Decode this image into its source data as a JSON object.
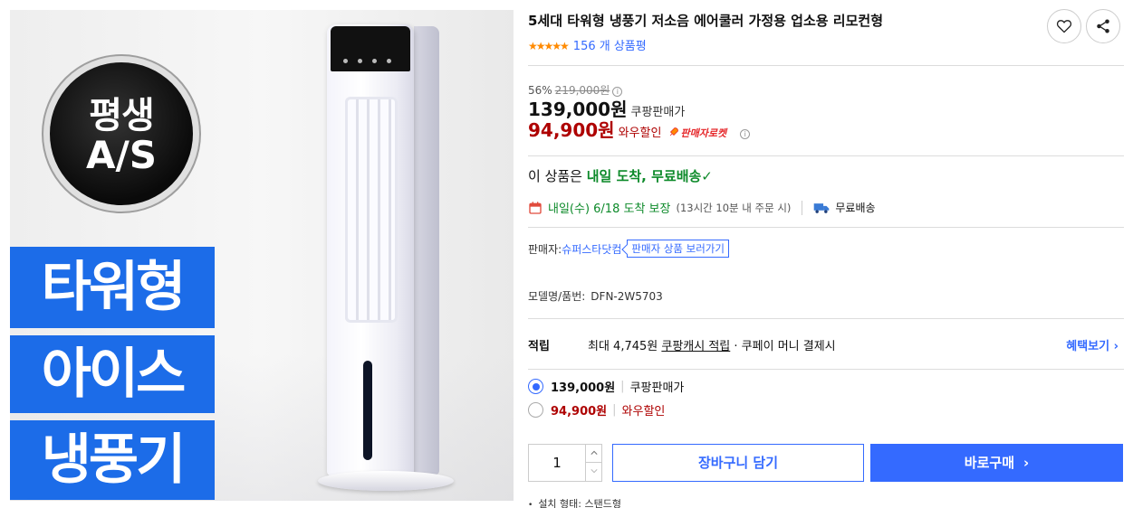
{
  "product": {
    "title": "5세대 타워형 냉풍기 저소음 에어쿨러 가정용 업소용 리모컨형",
    "stars": "★★★★★",
    "review_count": "156 개 상품평"
  },
  "image": {
    "badge_line1": "평생",
    "badge_line2": "A/S",
    "banner1": "타워형",
    "banner2": "아이스",
    "banner3": "냉풍기"
  },
  "price": {
    "discount_rate": "56%",
    "original": "219,000원",
    "sale": "139,000원",
    "sale_label": "쿠팡판매가",
    "wow": "94,900원",
    "wow_label": "와우할인",
    "rocket_label": "판매자로켓",
    "info_glyph": "i"
  },
  "delivery": {
    "headline_prefix": "이 상품은 ",
    "headline_green": "내일 도착, 무료배송",
    "check": "✓",
    "date": "내일(수) 6/18 도착 보장",
    "cutoff": "(13시간 10분 내 주문 시)",
    "free_shipping": "무료배송"
  },
  "seller": {
    "label": "판매자: ",
    "name": "슈퍼스타닷컴",
    "products_link": "판매자 상품 보러가기"
  },
  "model": {
    "label": "모델명/품번:",
    "code": "DFN-2W5703"
  },
  "cash": {
    "label": "적립",
    "max_text": "최대 4,745원 ",
    "coupang_cash": "쿠팡캐시 적립",
    "pay_text": " · 쿠페이 머니 결제시",
    "benefit_link": "혜택보기 ›"
  },
  "options": [
    {
      "price": "139,000원",
      "label": "쿠팡판매가",
      "selected": true
    },
    {
      "price": "94,900원",
      "label": "와우할인",
      "selected": false
    }
  ],
  "purchase": {
    "quantity": "1",
    "cart_button": "장바구니 담기",
    "buy_button": "바로구매",
    "buy_chevron": "›"
  },
  "spec": {
    "install_type": "설치 형태: 스탠드형"
  },
  "colors": {
    "accent_blue": "#346aff",
    "price_red": "#ae0000",
    "delivery_green": "#0d8a2a",
    "star_orange": "#ff8a00",
    "banner_blue": "#1c6ce8"
  }
}
